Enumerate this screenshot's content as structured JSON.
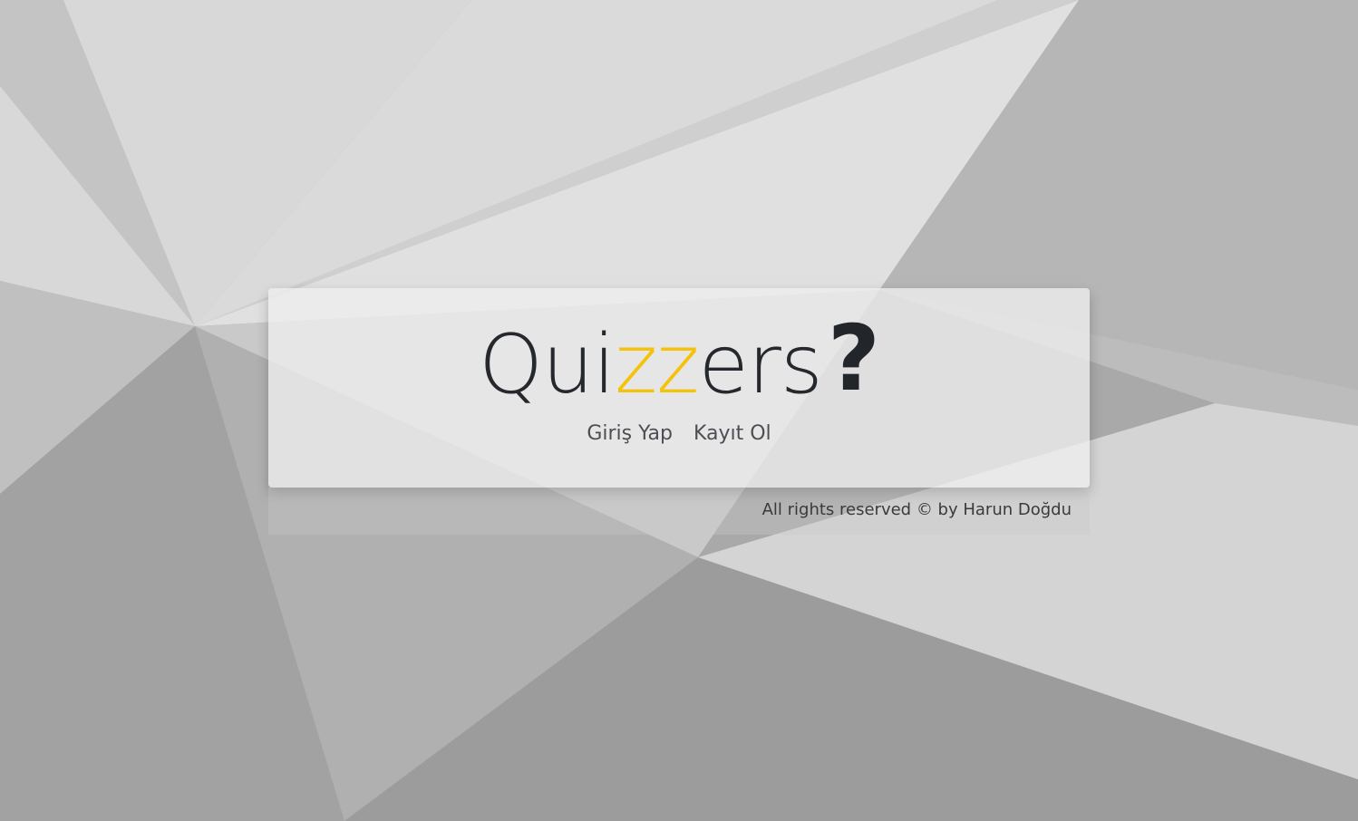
{
  "logo": {
    "part1": "Qui",
    "part2": "zz",
    "part3": "ers",
    "mark": "?"
  },
  "nav": {
    "login": "Giriş Yap",
    "register": "Kayıt Ol"
  },
  "footer": {
    "copyright": "All rights reserved © by Harun Doğdu"
  },
  "colors": {
    "accent": "#f5c20b",
    "logo_text": "#25282c",
    "background": "#a8a8a8"
  }
}
